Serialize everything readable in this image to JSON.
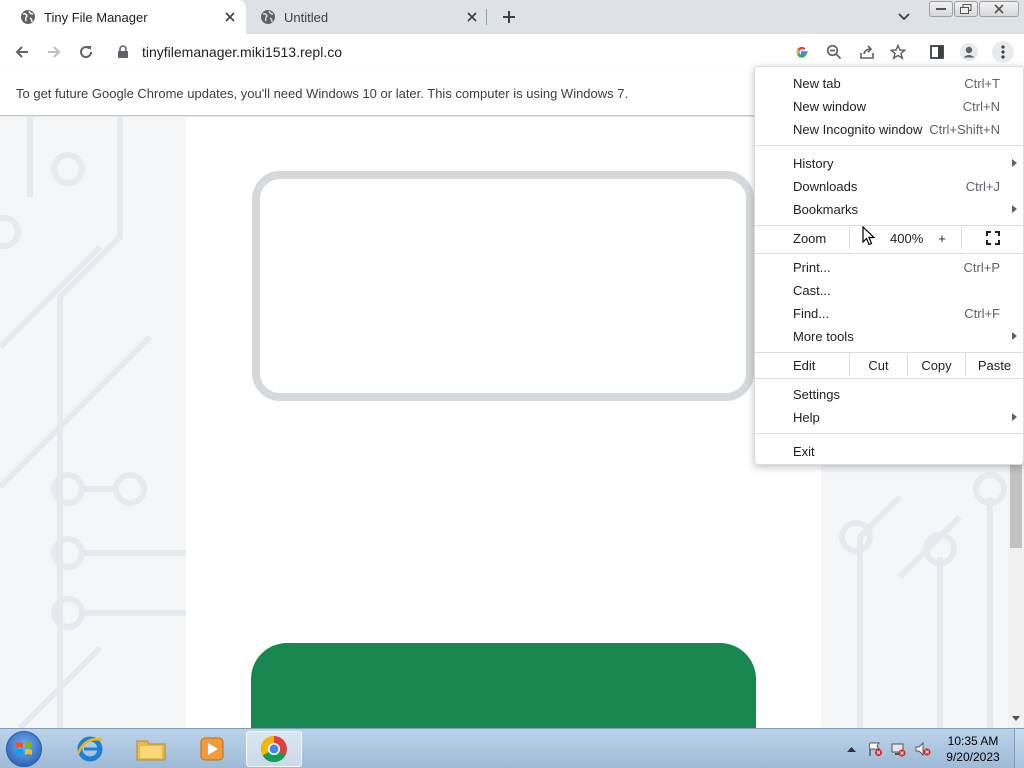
{
  "browser": {
    "tabs": [
      {
        "title": "Tiny File Manager",
        "active": true
      },
      {
        "title": "Untitled",
        "active": false
      }
    ],
    "url": "tinyfilemanager.miki1513.repl.co",
    "accent": "#1a73e8"
  },
  "infobar": {
    "message": "To get future Google Chrome updates, you'll need Windows 10 or later. This computer is using Windows 7."
  },
  "menu": {
    "group1": [
      {
        "label": "New tab",
        "shortcut": "Ctrl+T"
      },
      {
        "label": "New window",
        "shortcut": "Ctrl+N"
      },
      {
        "label": "New Incognito window",
        "shortcut": "Ctrl+Shift+N"
      }
    ],
    "group2": [
      {
        "label": "History",
        "shortcut": ""
      },
      {
        "label": "Downloads",
        "shortcut": "Ctrl+J"
      },
      {
        "label": "Bookmarks",
        "shortcut": ""
      }
    ],
    "zoom": {
      "label": "Zoom",
      "minus": "−",
      "value": "400%",
      "plus": "+"
    },
    "group3": [
      {
        "label": "Print...",
        "shortcut": "Ctrl+P"
      },
      {
        "label": "Cast...",
        "shortcut": ""
      },
      {
        "label": "Find...",
        "shortcut": "Ctrl+F"
      },
      {
        "label": "More tools",
        "shortcut": ""
      }
    ],
    "edit": {
      "label": "Edit",
      "cut": "Cut",
      "copy": "Copy",
      "paste": "Paste"
    },
    "group4": [
      {
        "label": "Settings",
        "shortcut": ""
      },
      {
        "label": "Help",
        "shortcut": ""
      }
    ],
    "exit": {
      "label": "Exit"
    }
  },
  "page": {
    "brand_green": "#17874f",
    "card_border": "#d5d9dc"
  },
  "taskbar": {
    "time": "10:35 AM",
    "date": "9/20/2023"
  }
}
